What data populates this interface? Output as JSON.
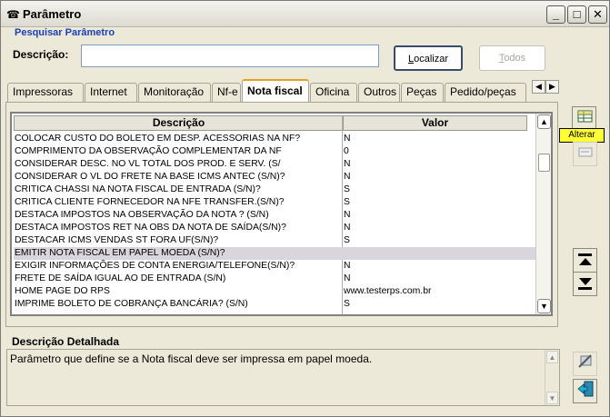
{
  "window": {
    "title": "Parâmetro",
    "minimize": "_",
    "maximize": "□",
    "close": "✕"
  },
  "search": {
    "section_title": "Pesquisar Parâmetro",
    "label": "Descrição:",
    "value": "",
    "localizar_key": "L",
    "localizar_rest": "ocalizar",
    "todos_key": "T",
    "todos_rest": "odos"
  },
  "tabs": [
    {
      "label": "Impressoras"
    },
    {
      "label": "Internet"
    },
    {
      "label": "Monitoração"
    },
    {
      "label": "Nf-e"
    },
    {
      "label": "Nota fiscal",
      "active": true
    },
    {
      "label": "Oficina"
    },
    {
      "label": "Outros"
    },
    {
      "label": "Peças"
    },
    {
      "label": "Pedido/peças"
    }
  ],
  "grid": {
    "columns": [
      "Descrição",
      "Valor"
    ],
    "rows": [
      {
        "descricao": "COLOCAR CUSTO DO BOLETO EM DESP. ACESSORIAS NA NF?",
        "valor": "N"
      },
      {
        "descricao": "COMPRIMENTO DA OBSERVAÇÃO COMPLEMENTAR DA NF",
        "valor": "0"
      },
      {
        "descricao": "CONSIDERAR DESC. NO VL TOTAL DOS PROD. E SERV. (S/",
        "valor": "N"
      },
      {
        "descricao": "CONSIDERAR O VL DO FRETE NA BASE ICMS ANTEC (S/N)?",
        "valor": "N"
      },
      {
        "descricao": "CRITICA CHASSI NA NOTA FISCAL DE ENTRADA (S/N)?",
        "valor": "S"
      },
      {
        "descricao": "CRITICA CLIENTE FORNECEDOR NA NFE TRANSFER.(S/N)?",
        "valor": "S"
      },
      {
        "descricao": "DESTACA IMPOSTOS NA OBSERVAÇÃO DA NOTA ? (S/N)",
        "valor": "N"
      },
      {
        "descricao": "DESTACA IMPOSTOS RET NA OBS DA NOTA DE SAÍDA(S/N)?",
        "valor": "N"
      },
      {
        "descricao": "DESTACAR ICMS VENDAS ST FORA UF(S/N)?",
        "valor": "S"
      },
      {
        "descricao": "EMITIR NOTA FISCAL EM PAPEL MOEDA (S/N)?",
        "valor": "",
        "selected": true
      },
      {
        "descricao": "EXIGIR INFORMAÇÕES DE CONTA ENERGIA/TELEFONE(S/N)?",
        "valor": "N"
      },
      {
        "descricao": "FRETE DE SAÍDA IGUAL AO DE ENTRADA (S/N)",
        "valor": "N"
      },
      {
        "descricao": "HOME PAGE DO RPS",
        "valor": "www.testerps.com.br"
      },
      {
        "descricao": "IMPRIME BOLETO DE COBRANÇA BANCÁRIA? (S/N)",
        "valor": "S"
      }
    ]
  },
  "detail": {
    "title": "Descrição Detalhada",
    "text": "Parâmetro que define se a Nota fiscal deve ser impressa em papel moeda."
  },
  "side": {
    "tooltip": "Alterar"
  }
}
